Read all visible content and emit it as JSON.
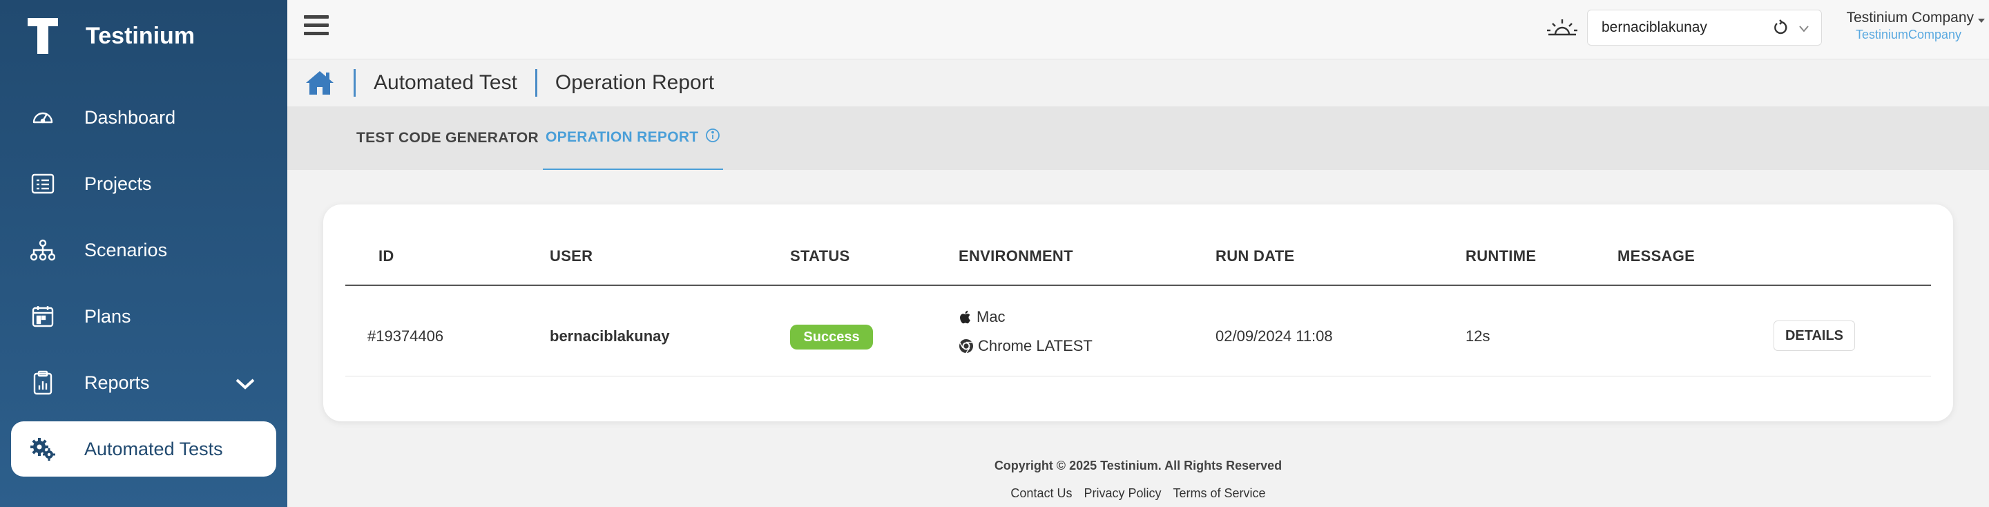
{
  "brand": {
    "name": "Testinium"
  },
  "sidebar": {
    "items": [
      {
        "label": "Dashboard",
        "icon": "speedometer-icon"
      },
      {
        "label": "Projects",
        "icon": "list-card-icon"
      },
      {
        "label": "Scenarios",
        "icon": "hierarchy-icon"
      },
      {
        "label": "Plans",
        "icon": "calendar-icon"
      },
      {
        "label": "Reports",
        "icon": "clipboard-chart-icon"
      },
      {
        "label": "Automated Tests",
        "icon": "gears-icon"
      }
    ],
    "active": "Automated Tests"
  },
  "topbar": {
    "user": "bernaciblakunay",
    "company_name": "Testinium Company",
    "company_sub": "TestiniumCompany"
  },
  "breadcrumb": {
    "items": [
      "Automated Test",
      "Operation Report"
    ]
  },
  "tabs": [
    {
      "label": "TEST CODE GENERATOR"
    },
    {
      "label": "OPERATION REPORT",
      "active": true
    }
  ],
  "table": {
    "headers": [
      "ID",
      "USER",
      "STATUS",
      "ENVIRONMENT",
      "RUN DATE",
      "RUNTIME",
      "MESSAGE"
    ],
    "rows": [
      {
        "id": "#19374406",
        "user": "bernaciblakunay",
        "status": "Success",
        "env_os": "Mac",
        "env_browser": "Chrome LATEST",
        "run_date": "02/09/2024 11:08",
        "runtime": "12s",
        "message": "",
        "action": "DETAILS"
      }
    ]
  },
  "footer": {
    "copyright": "Copyright © 2025 Testinium. All Rights Reserved",
    "links": [
      "Contact Us",
      "Privacy Policy",
      "Terms of Service"
    ]
  },
  "colors": {
    "sidebar": "#2d5f8c",
    "accent": "#4a9fd8",
    "success": "#78c23f"
  }
}
